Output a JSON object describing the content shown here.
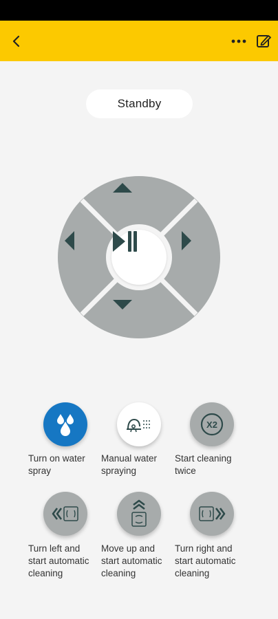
{
  "status": {
    "label": "Standby"
  },
  "colors": {
    "header": "#fcc900",
    "pad_gray": "#a7abab",
    "icon_dark": "#2e4a4a",
    "water_blue": "#1677c3"
  },
  "icons": {
    "back": "chevron-left",
    "more": "three-dots",
    "edit": "edit-pencil",
    "up": "triangle-up",
    "down": "triangle-down",
    "left": "triangle-left",
    "right": "triangle-right",
    "center": "play-pause"
  },
  "modes": [
    {
      "label": "Turn on water\nspray",
      "icon": "water-drops-icon"
    },
    {
      "label": "Manual water\nspraying",
      "icon": "manual-spray-icon"
    },
    {
      "label": "Start cleaning\ntwice",
      "icon": "x2-icon",
      "badge": "X2"
    },
    {
      "label": "Turn left  and\nstart automatic\ncleaning",
      "icon": "turn-left-icon"
    },
    {
      "label": "Move up and\nstart automatic\ncleaning",
      "icon": "move-up-icon"
    },
    {
      "label": "Turn right and\nstart automatic\ncleaning",
      "icon": "turn-right-icon"
    }
  ]
}
